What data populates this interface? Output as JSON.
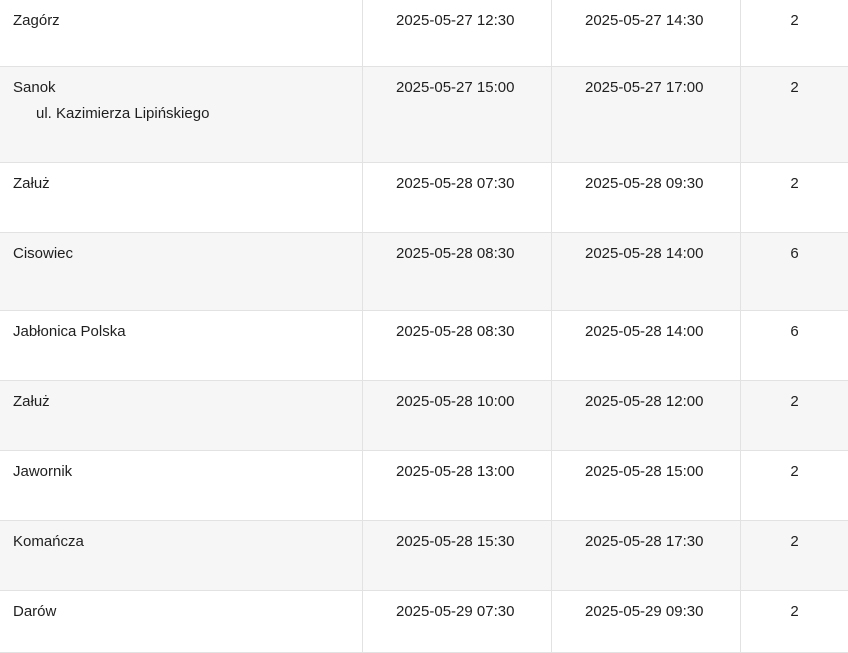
{
  "rows": [
    {
      "location": "Zagórz",
      "address": "",
      "start": "2025-05-27 12:30",
      "end": "2025-05-27 14:30",
      "count": "2"
    },
    {
      "location": "Sanok",
      "address": "ul. Kazimierza Lipińskiego",
      "start": "2025-05-27 15:00",
      "end": "2025-05-27 17:00",
      "count": "2"
    },
    {
      "location": "Załuż",
      "address": "",
      "start": "2025-05-28 07:30",
      "end": "2025-05-28 09:30",
      "count": "2"
    },
    {
      "location": "Cisowiec",
      "address": "",
      "start": "2025-05-28 08:30",
      "end": "2025-05-28 14:00",
      "count": "6"
    },
    {
      "location": "Jabłonica Polska",
      "address": "",
      "start": "2025-05-28 08:30",
      "end": "2025-05-28 14:00",
      "count": "6"
    },
    {
      "location": "Załuż",
      "address": "",
      "start": "2025-05-28 10:00",
      "end": "2025-05-28 12:00",
      "count": "2"
    },
    {
      "location": "Jawornik",
      "address": "",
      "start": "2025-05-28 13:00",
      "end": "2025-05-28 15:00",
      "count": "2"
    },
    {
      "location": "Komańcza",
      "address": "",
      "start": "2025-05-28 15:30",
      "end": "2025-05-28 17:30",
      "count": "2"
    },
    {
      "location": "Darów",
      "address": "",
      "start": "2025-05-29 07:30",
      "end": "2025-05-29 09:30",
      "count": "2"
    }
  ]
}
